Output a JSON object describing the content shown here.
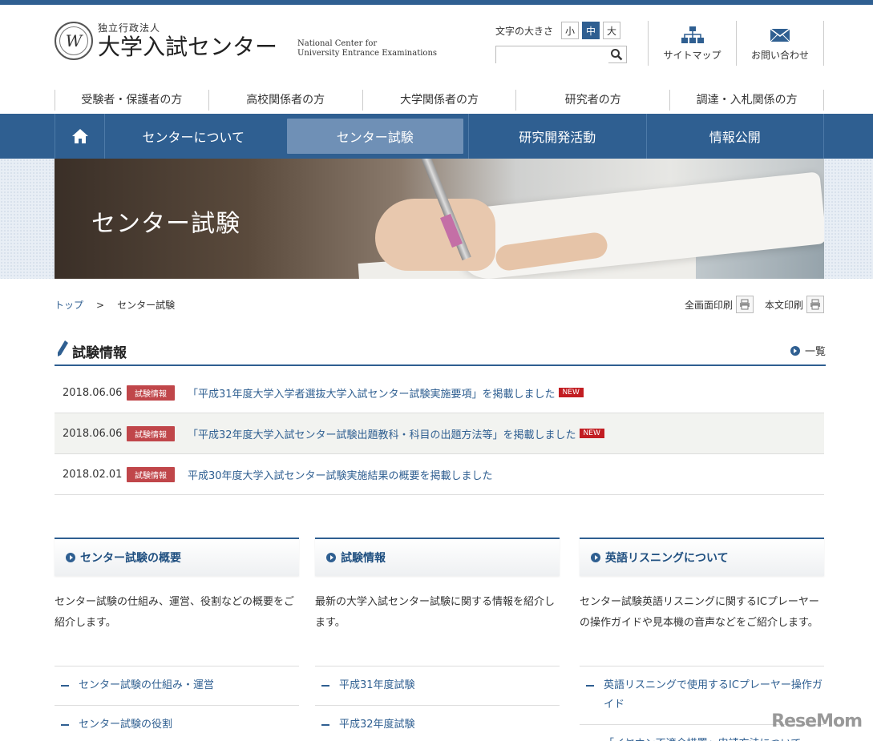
{
  "header": {
    "logo_sub": "独立行政法人",
    "logo_main": "大学入試センター",
    "logo_en_1": "National Center for",
    "logo_en_2": "University Entrance Examinations",
    "fontsize_label": "文字の大きさ",
    "fontsize_options": [
      "小",
      "中",
      "大"
    ],
    "fontsize_selected": "中",
    "search_placeholder": "",
    "sitemap_label": "サイトマップ",
    "contact_label": "お問い合わせ"
  },
  "audience_nav": [
    "受験者・保護者の方",
    "高校関係者の方",
    "大学関係者の方",
    "研究者の方",
    "調達・入札関係の方"
  ],
  "main_nav": {
    "items": [
      "センターについて",
      "センター試験",
      "研究開発活動",
      "情報公開"
    ],
    "active": "センター試験"
  },
  "hero": {
    "title": "センター試験"
  },
  "breadcrumb": {
    "home": "トップ",
    "separator": ">",
    "current": "センター試験"
  },
  "print": {
    "full": "全画面印刷",
    "body": "本文印刷"
  },
  "news_section": {
    "title": "試験情報",
    "all_link": "一覧",
    "items": [
      {
        "date": "2018.06.06",
        "tag": "試験情報",
        "text": "「平成31年度大学入学者選抜大学入試センター試験実施要項」を掲載しました",
        "new": "NEW"
      },
      {
        "date": "2018.06.06",
        "tag": "試験情報",
        "text": "「平成32年度大学入試センター試験出題教科・科目の出題方法等」を掲載しました",
        "new": "NEW"
      },
      {
        "date": "2018.02.01",
        "tag": "試験情報",
        "text": "平成30年度大学入試センター試験実施結果の概要を掲載しました",
        "new": ""
      }
    ]
  },
  "columns": [
    {
      "title": "センター試験の概要",
      "desc": "センター試験の仕組み、運営、役割などの概要をご紹介します。",
      "links": [
        "センター試験の仕組み・運営",
        "センター試験の役割"
      ]
    },
    {
      "title": "試験情報",
      "desc": "最新の大学入試センター試験に関する情報を紹介します。",
      "links": [
        "平成31年度試験",
        "平成32年度試験"
      ]
    },
    {
      "title": "英語リスニングについて",
      "desc": "センター試験英語リスニングに関するICプレーヤーの操作ガイドや見本機の音声などをご紹介します。",
      "links": [
        "英語リスニングで使用するICプレーヤー操作ガイド",
        "「イヤホン不適合措置」申請方法について"
      ]
    }
  ],
  "watermark": "ReseMom",
  "colors": {
    "brand": "#2f5f91",
    "tag": "#c0464a",
    "new_badge": "#c21d22"
  }
}
